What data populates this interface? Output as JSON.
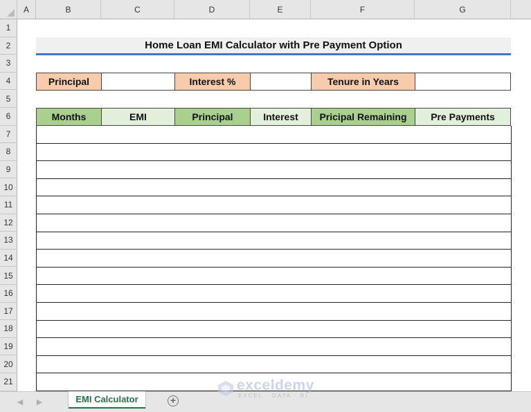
{
  "spreadsheet": {
    "columns": [
      "A",
      "B",
      "C",
      "D",
      "E",
      "F",
      "G"
    ],
    "rows": [
      "1",
      "2",
      "3",
      "4",
      "5",
      "6",
      "7",
      "8",
      "9",
      "10",
      "11",
      "12",
      "13",
      "14",
      "15",
      "16",
      "17",
      "18",
      "19",
      "20",
      "21"
    ]
  },
  "title": "Home Loan EMI Calculator with Pre Payment Option",
  "inputs": {
    "principal_label": "Principal",
    "principal_value": "",
    "interest_label": "Interest %",
    "interest_value": "",
    "tenure_label": "Tenure in Years",
    "tenure_value": ""
  },
  "table": {
    "headers": [
      "Months",
      "EMI",
      "Principal",
      "Interest",
      "Pricipal Remaining",
      "Pre Payments"
    ],
    "empty_rows": 15
  },
  "sheet_tabs": {
    "active": "EMI Calculator",
    "add_icon": "plus-circle-icon",
    "prev_icon": "chevron-left-icon",
    "next_icon": "chevron-right-icon"
  },
  "watermark": {
    "name": "exceldemy",
    "tagline": "EXCEL · DATA · BI"
  },
  "colors": {
    "input_label_bg": "#f8cbad",
    "header_dark_green": "#a9d08e",
    "header_light_green": "#e2efda",
    "title_underline": "#4472c4",
    "active_tab_text": "#217346"
  }
}
